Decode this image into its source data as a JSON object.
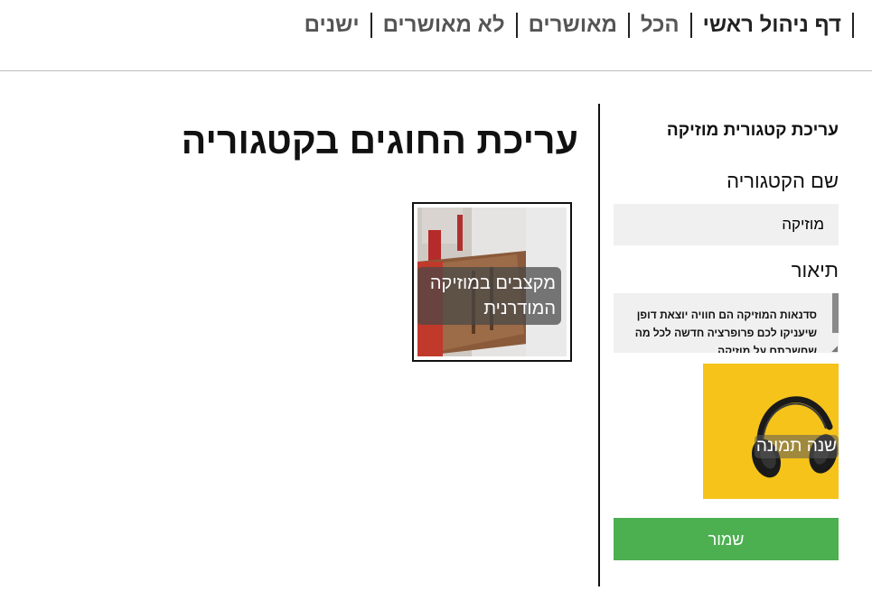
{
  "nav": {
    "items": [
      {
        "label": "דף ניהול ראשי"
      },
      {
        "label": "הכל"
      },
      {
        "label": "מאושרים"
      },
      {
        "label": "לא מאושרים"
      },
      {
        "label": "ישנים"
      }
    ]
  },
  "main": {
    "title": "עריכת החוגים בקטגוריה",
    "cards": [
      {
        "caption": "מקצבים במוזיקה המודרנית"
      }
    ]
  },
  "form": {
    "title": "עריכת קטגורית מוזיקה",
    "name_label": "שם הקטגוריה",
    "name_value": "מוזיקה",
    "description_label": "תיאור",
    "description_value": "סדנאות המוזיקה הם חוויה יוצאת דופן שיעניקו לכם פרופרציה חדשה לכל מה שחשבתם על מוזיקה",
    "image_caption": "שנה תמונה",
    "save_label": "שמור"
  },
  "colors": {
    "save_button": "#4caf50",
    "input_background": "#f0f0f0",
    "image_background": "#f5c31a"
  }
}
